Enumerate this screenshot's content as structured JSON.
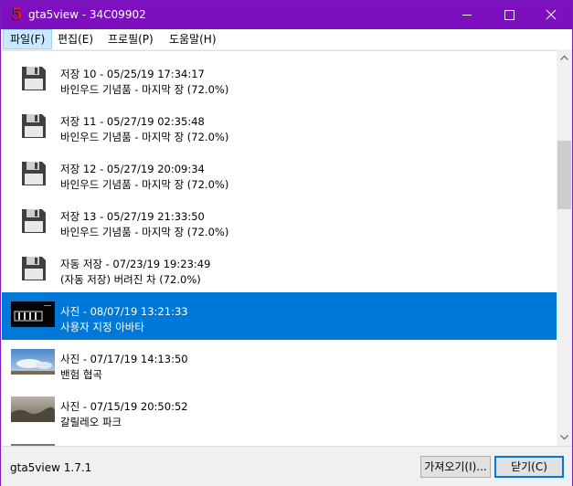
{
  "window": {
    "title": "gta5view - 34C09902",
    "app_icon_glyph": "5"
  },
  "menu": [
    {
      "label": "파일(F)",
      "active": true
    },
    {
      "label": "편집(E)",
      "active": false
    },
    {
      "label": "프로필(P)",
      "active": false
    },
    {
      "label": "도움말(H)",
      "active": false
    }
  ],
  "items": [
    {
      "type": "save",
      "line1": "저장 10 - 05/25/19 17:34:17",
      "line2": "바인우드 기념품 - 마지막 장 (72.0%)"
    },
    {
      "type": "save",
      "line1": "저장 11 - 05/27/19 02:35:48",
      "line2": "바인우드 기념품 - 마지막 장 (72.0%)"
    },
    {
      "type": "save",
      "line1": "저장 12 - 05/27/19 20:09:34",
      "line2": "바인우드 기념품 - 마지막 장 (72.0%)"
    },
    {
      "type": "save",
      "line1": "저장 13 - 05/27/19 21:33:50",
      "line2": "바인우드 기념품 - 마지막 장 (72.0%)"
    },
    {
      "type": "save",
      "line1": "자동 저장 - 07/23/19 19:23:49",
      "line2": "(자동 저장) 버려진 차 (72.0%)"
    },
    {
      "type": "photo",
      "thumb": "dark",
      "selected": true,
      "line1": "사진 - 08/07/19 13:21:33",
      "line2": "사용자 지정 아바타"
    },
    {
      "type": "photo",
      "thumb": "sky",
      "line1": "사진 - 07/17/19 14:13:50",
      "line2": "밴험 협곡"
    },
    {
      "type": "photo",
      "thumb": "fog",
      "line1": "사진 - 07/15/19 20:50:52",
      "line2": "갈릴레오 파크"
    }
  ],
  "status": {
    "version": "gta5view 1.7.1"
  },
  "buttons": {
    "import": "가져오기(I)...",
    "close": "닫기(C)"
  },
  "colors": {
    "titlebar": "#7e0fbf",
    "selection": "#0078d7"
  }
}
